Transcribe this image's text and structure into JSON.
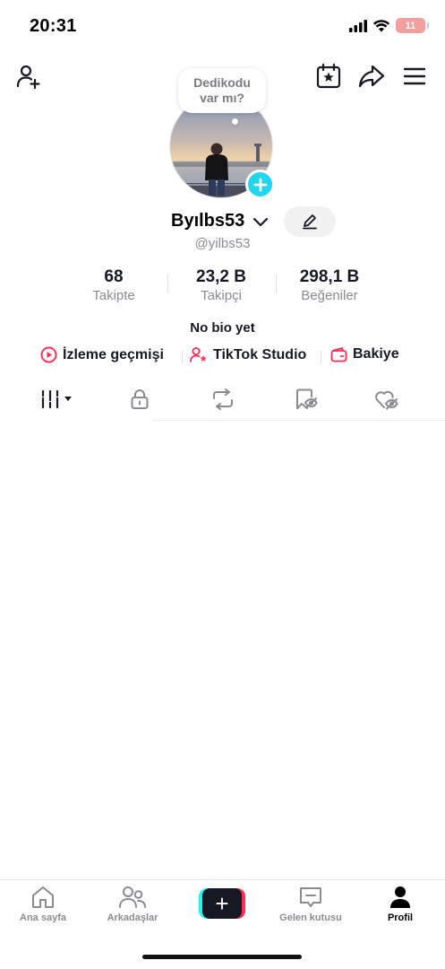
{
  "status": {
    "time": "20:31",
    "battery": "11"
  },
  "profile": {
    "bubble_text": "Dedikodu var mı?",
    "display_name": "Byılbs53",
    "username": "@yilbs53",
    "bio": "No bio yet"
  },
  "stats": [
    {
      "value": "68",
      "label": "Takipte"
    },
    {
      "value": "23,2 B",
      "label": "Takipçi"
    },
    {
      "value": "298,1 B",
      "label": "Beğeniler"
    }
  ],
  "links": [
    {
      "label": "İzleme geçmişi",
      "icon": "play-circle-icon"
    },
    {
      "label": "TikTok Studio",
      "icon": "creator-star-icon"
    },
    {
      "label": "Bakiye",
      "icon": "wallet-icon"
    }
  ],
  "tabs": [
    "videos-grid-icon",
    "lock-icon",
    "repost-icon",
    "saved-icon",
    "liked-icon"
  ],
  "nav": [
    {
      "label": "Ana sayfa",
      "icon": "home-icon"
    },
    {
      "label": "Arkadaşlar",
      "icon": "friends-icon"
    },
    {
      "label": "",
      "icon": "create-plus-icon"
    },
    {
      "label": "Gelen kutusu",
      "icon": "inbox-icon"
    },
    {
      "label": "Profil",
      "icon": "profile-icon"
    }
  ],
  "colors": {
    "accent_red": "#fe2c55",
    "accent_cyan": "#20d5ec",
    "text": "#161823",
    "muted": "#8a8b91"
  }
}
